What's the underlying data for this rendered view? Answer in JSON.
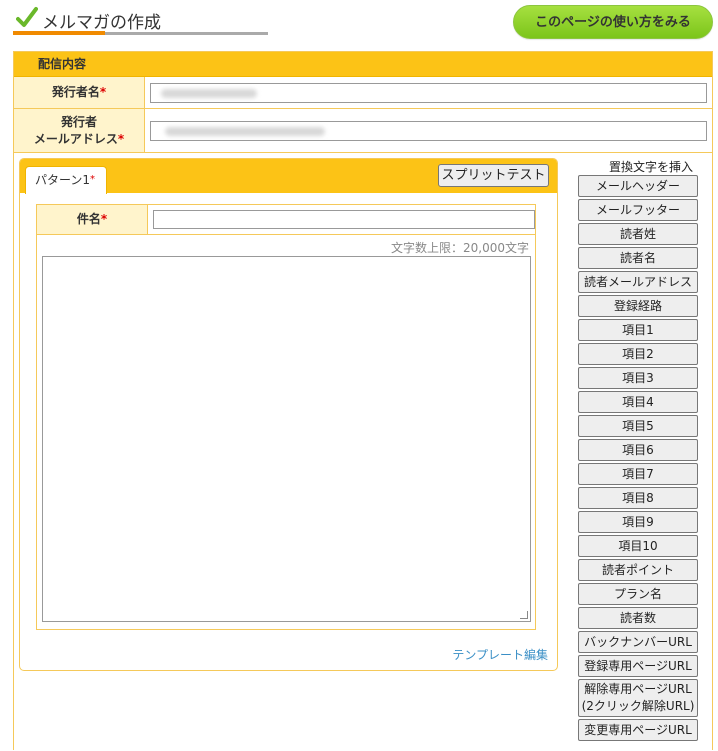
{
  "header": {
    "title": "メルマガの作成",
    "help_button": "このページの使い方をみる",
    "check_icon": "check-icon"
  },
  "colors": {
    "section_header": "#fcc316",
    "label_bg": "#fff4cc",
    "help_button": "#8cc63f",
    "link": "#3a8fc6",
    "required": "#dd0000"
  },
  "section": {
    "title": "配信内容",
    "sender_name_label": "発行者名",
    "sender_email_label_1": "発行者",
    "sender_email_label_2": "メールアドレス",
    "required_mark": "*"
  },
  "pattern": {
    "tab_label": "パターン1",
    "tab_mark": "*",
    "split_test_button": "スプリットテスト",
    "subject_label": "件名",
    "char_limit": "文字数上限：20,000文字",
    "template_link": "テンプレート編集"
  },
  "replacements": {
    "title": "置換文字を挿入",
    "items": [
      "メールヘッダー",
      "メールフッター",
      "読者姓",
      "読者名",
      "読者メールアドレス",
      "登録経路",
      "項目1",
      "項目2",
      "項目3",
      "項目4",
      "項目5",
      "項目6",
      "項目7",
      "項目8",
      "項目9",
      "項目10",
      "読者ポイント",
      "プラン名",
      "読者数",
      "バックナンバーURL",
      "登録専用ページURL",
      "解除専用ページURL (2クリック解除URL)",
      "変更専用ページURL"
    ],
    "two_line_1": "解除専用ページURL",
    "two_line_2": "(2クリック解除URL)"
  }
}
